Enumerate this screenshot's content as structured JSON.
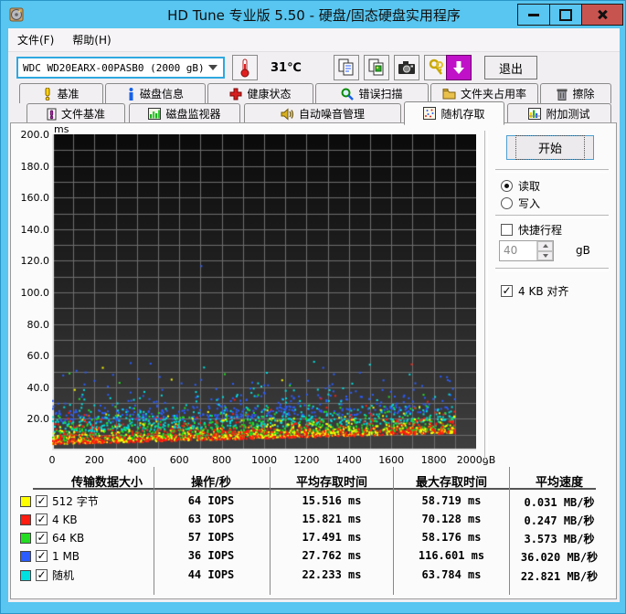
{
  "window": {
    "title": "HD Tune 专业版 5.50 - 硬盘/固态硬盘实用程序"
  },
  "menu": {
    "items": [
      "文件(F)",
      "帮助(H)"
    ]
  },
  "toolbar": {
    "drive_select": "WDC WD20EARX-00PASB0 (2000 gB)",
    "temperature": "31℃",
    "exit_label": "退出"
  },
  "tabs": {
    "row1": [
      {
        "label": "基准"
      },
      {
        "label": "磁盘信息"
      },
      {
        "label": "健康状态"
      },
      {
        "label": "错误扫描"
      },
      {
        "label": "文件夹占用率"
      },
      {
        "label": "擦除"
      }
    ],
    "row2": [
      {
        "label": "文件基准"
      },
      {
        "label": "磁盘监视器"
      },
      {
        "label": "自动噪音管理"
      },
      {
        "label": "随机存取",
        "active": true
      },
      {
        "label": "附加测试"
      }
    ]
  },
  "panel": {
    "start_label": "开始",
    "read_label": "读取",
    "write_label": "写入",
    "short_stroke_label": "快捷行程",
    "short_stroke_value": "40",
    "short_stroke_unit": "gB",
    "align_label": "4 KB 对齐"
  },
  "table": {
    "headers": [
      "传输数据大小",
      "操作/秒",
      "平均存取时间",
      "最大存取时间",
      "平均速度"
    ],
    "rows": [
      {
        "color": "#ffff00",
        "label": "512 字节",
        "iops": "64 IOPS",
        "avg": "15.516 ms",
        "max": "58.719 ms",
        "speed": "0.031 MB/秒"
      },
      {
        "color": "#ff1c10",
        "label": "4 KB",
        "iops": "63 IOPS",
        "avg": "15.821 ms",
        "max": "70.128 ms",
        "speed": "0.247 MB/秒"
      },
      {
        "color": "#22dd22",
        "label": "64 KB",
        "iops": "57 IOPS",
        "avg": "17.491 ms",
        "max": "58.176 ms",
        "speed": "3.573 MB/秒"
      },
      {
        "color": "#2a5cff",
        "label": "1 MB",
        "iops": "36 IOPS",
        "avg": "27.762 ms",
        "max": "116.601 ms",
        "speed": "36.020 MB/秒"
      },
      {
        "color": "#00e0e0",
        "label": "随机",
        "iops": "44 IOPS",
        "avg": "22.233 ms",
        "max": "63.784 ms",
        "speed": "22.821 MB/秒"
      }
    ]
  },
  "chart_data": {
    "type": "scatter",
    "title": "随机存取 access time vs disk position",
    "x_unit": "gB",
    "y_unit": "ms",
    "xlim": [
      0,
      2000
    ],
    "ylim": [
      0,
      200
    ],
    "grid_step_x": 100,
    "grid_step_y": 10,
    "x_ticks": [
      {
        "value": 0,
        "label": "0"
      },
      {
        "value": 200,
        "label": "200"
      },
      {
        "value": 400,
        "label": "400"
      },
      {
        "value": 600,
        "label": "600"
      },
      {
        "value": 800,
        "label": "800"
      },
      {
        "value": 1000,
        "label": "1000"
      },
      {
        "value": 1200,
        "label": "1200"
      },
      {
        "value": 1400,
        "label": "1400"
      },
      {
        "value": 1600,
        "label": "1600"
      },
      {
        "value": 1800,
        "label": "1800"
      },
      {
        "value": 2000,
        "label": "2000gB"
      }
    ],
    "y_ticks": [
      {
        "value": 200,
        "label": "200.0"
      },
      {
        "value": 180,
        "label": "180.0"
      },
      {
        "value": 160,
        "label": "160.0"
      },
      {
        "value": 140,
        "label": "140.0"
      },
      {
        "value": 120,
        "label": "120.0"
      },
      {
        "value": 100,
        "label": "100.0"
      },
      {
        "value": 80,
        "label": "80.0"
      },
      {
        "value": 60,
        "label": "60.0"
      },
      {
        "value": 40,
        "label": "40.0"
      },
      {
        "value": 20,
        "label": "20.0"
      }
    ],
    "envelope": {
      "base_ms": 3.5,
      "slope_ms": 7.5
    },
    "x_data_max": 1900,
    "series": [
      {
        "name": "1 MB",
        "color": "#2a5cff",
        "count": 430,
        "offset": 13.5,
        "spread": 7.5,
        "max_ms": 116.601,
        "outlier_rate": 0.05,
        "outlier_range": [
          35,
          60
        ],
        "iops": 36,
        "avg_ms": 27.762
      },
      {
        "name": "随机",
        "color": "#00e0e0",
        "count": 480,
        "offset": 7.5,
        "spread": 6.5,
        "max_ms": 63.784,
        "outlier_rate": 0.04,
        "outlier_range": [
          30,
          58
        ],
        "iops": 44,
        "avg_ms": 22.233
      },
      {
        "name": "64 KB",
        "color": "#22dd22",
        "count": 680,
        "offset": 2.0,
        "spread": 5.5,
        "max_ms": 58.176,
        "outlier_rate": 0.01,
        "outlier_range": [
          25,
          55
        ],
        "iops": 57,
        "avg_ms": 17.491
      },
      {
        "name": "512 字节",
        "color": "#ffff00",
        "count": 680,
        "offset": 0.4,
        "spread": 4.5,
        "max_ms": 58.719,
        "outlier_rate": 0.008,
        "outlier_range": [
          25,
          55
        ],
        "iops": 64,
        "avg_ms": 15.516
      },
      {
        "name": "4 KB",
        "color": "#ff1c10",
        "count": 680,
        "offset": 0.1,
        "spread": 5.0,
        "max_ms": 70.128,
        "outlier_rate": 0.008,
        "outlier_range": [
          25,
          58
        ],
        "iops": 63,
        "avg_ms": 15.821
      }
    ],
    "extra_points": [
      {
        "series": "1 MB",
        "color": "#2a5cff",
        "x": 704,
        "y": 116.6
      }
    ]
  }
}
